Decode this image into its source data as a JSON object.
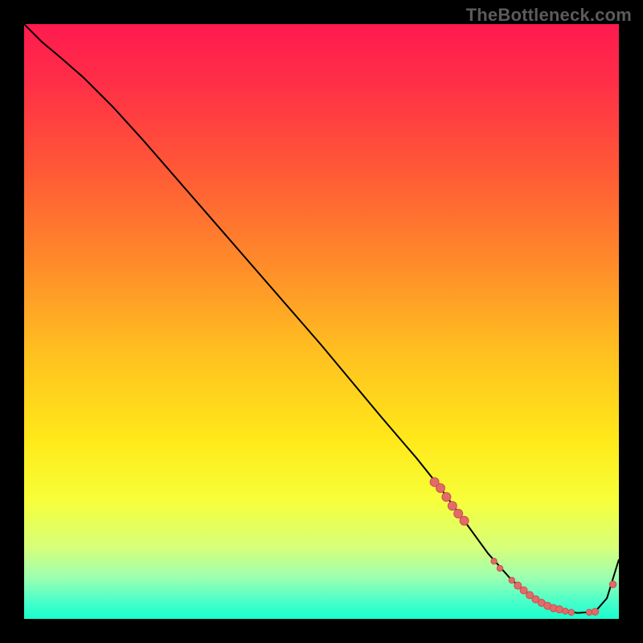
{
  "watermark": "TheBottleneck.com",
  "colors": {
    "bg": "#000000",
    "gradient_stops": [
      {
        "offset": 0.0,
        "color": "#ff1a4f"
      },
      {
        "offset": 0.1,
        "color": "#ff2f47"
      },
      {
        "offset": 0.25,
        "color": "#ff5a36"
      },
      {
        "offset": 0.4,
        "color": "#ff8a2a"
      },
      {
        "offset": 0.55,
        "color": "#ffbf20"
      },
      {
        "offset": 0.7,
        "color": "#ffe91a"
      },
      {
        "offset": 0.8,
        "color": "#f7ff39"
      },
      {
        "offset": 0.88,
        "color": "#d7ff7a"
      },
      {
        "offset": 0.93,
        "color": "#9dffb0"
      },
      {
        "offset": 0.97,
        "color": "#4bffc9"
      },
      {
        "offset": 1.0,
        "color": "#18ffce"
      }
    ],
    "curve": "#000000",
    "dot_fill": "#e46a6a",
    "dot_stroke": "#c65050"
  },
  "chart_data": {
    "type": "line",
    "title": "",
    "xlabel": "",
    "ylabel": "",
    "xlim": [
      0,
      100
    ],
    "ylim": [
      0,
      100
    ],
    "series": [
      {
        "name": "curve",
        "x": [
          0,
          3,
          6,
          10,
          15,
          20,
          30,
          40,
          50,
          60,
          66,
          70,
          74,
          78,
          82,
          86,
          90,
          93,
          96,
          98,
          100
        ],
        "y": [
          100,
          97,
          94.5,
          91,
          86,
          80.5,
          69,
          57.5,
          46,
          34,
          27,
          22,
          16.5,
          11,
          6.5,
          3.3,
          1.6,
          1.0,
          1.2,
          3.5,
          10
        ]
      }
    ],
    "markers": [
      {
        "x": 69,
        "y": 23.0,
        "r": 5.5
      },
      {
        "x": 70,
        "y": 22.0,
        "r": 5.5
      },
      {
        "x": 71,
        "y": 20.5,
        "r": 5.5
      },
      {
        "x": 72,
        "y": 19.0,
        "r": 5.5
      },
      {
        "x": 73,
        "y": 17.7,
        "r": 5.5
      },
      {
        "x": 74,
        "y": 16.5,
        "r": 5.5
      },
      {
        "x": 79,
        "y": 9.7,
        "r": 3.7
      },
      {
        "x": 80,
        "y": 8.5,
        "r": 3.7
      },
      {
        "x": 82,
        "y": 6.5,
        "r": 3.7
      },
      {
        "x": 83,
        "y": 5.6,
        "r": 4.5
      },
      {
        "x": 84,
        "y": 4.8,
        "r": 4.5
      },
      {
        "x": 85,
        "y": 4.0,
        "r": 4.5
      },
      {
        "x": 86,
        "y": 3.3,
        "r": 4.5
      },
      {
        "x": 87,
        "y": 2.7,
        "r": 4.5
      },
      {
        "x": 88,
        "y": 2.2,
        "r": 4.5
      },
      {
        "x": 89,
        "y": 1.8,
        "r": 4.5
      },
      {
        "x": 90,
        "y": 1.6,
        "r": 4.5
      },
      {
        "x": 91,
        "y": 1.3,
        "r": 3.7
      },
      {
        "x": 92,
        "y": 1.1,
        "r": 3.7
      },
      {
        "x": 95,
        "y": 1.1,
        "r": 3.7
      },
      {
        "x": 96,
        "y": 1.2,
        "r": 4.2
      },
      {
        "x": 99,
        "y": 5.8,
        "r": 4.2
      }
    ]
  }
}
